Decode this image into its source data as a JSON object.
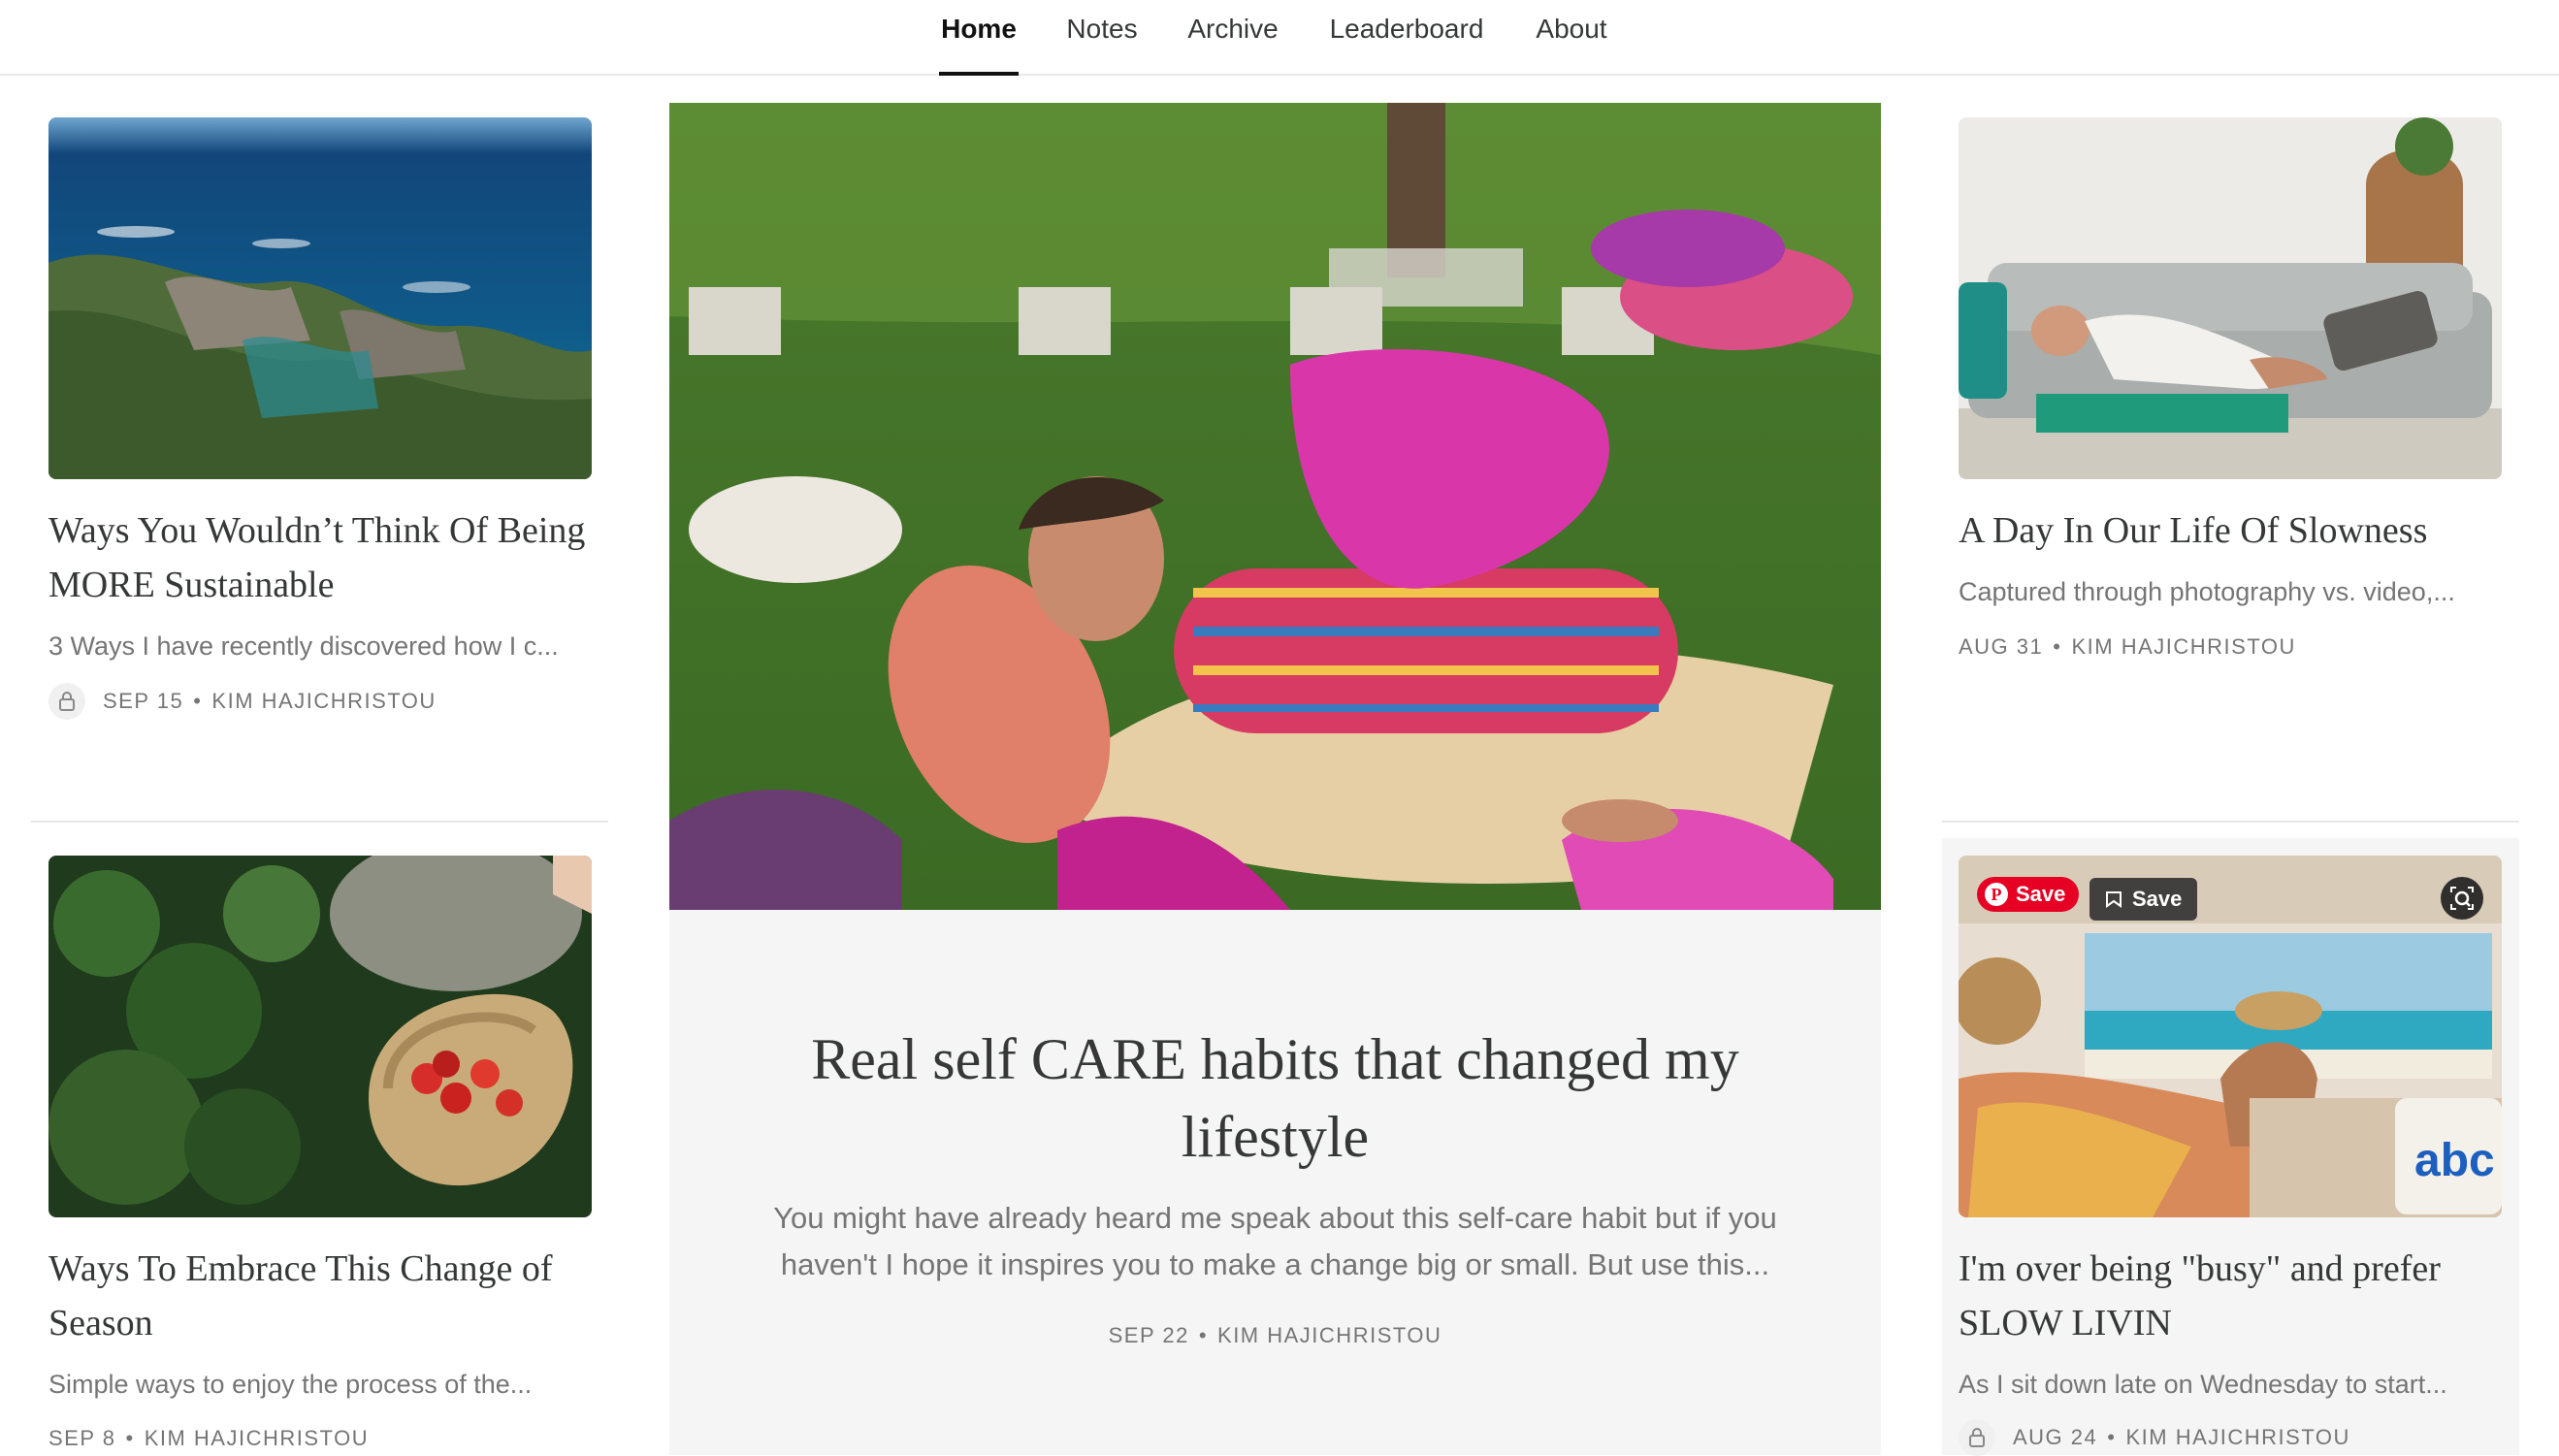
{
  "nav": {
    "items": [
      {
        "label": "Home",
        "active": true
      },
      {
        "label": "Notes"
      },
      {
        "label": "Archive"
      },
      {
        "label": "Leaderboard"
      },
      {
        "label": "About"
      }
    ]
  },
  "left": {
    "post1": {
      "title": "Ways You Wouldn’t Think Of Being MORE Sustainable",
      "subtitle": "3 Ways I have recently discovered how I c...",
      "date": "SEP 15",
      "author": "KIM HAJICHRISTOU",
      "locked": true
    },
    "post2": {
      "title": "Ways To Embrace This Change of Season",
      "subtitle": "Simple ways to enjoy the process of the...",
      "date": "SEP 8",
      "author": "KIM HAJICHRISTOU"
    }
  },
  "featured": {
    "title": "Real self CARE habits that changed my lifestyle",
    "subtitle": "You might have already heard me speak about this self-care habit but if you haven't I hope it inspires you to make a change big or small. But use this...",
    "date": "SEP 22",
    "author": "KIM HAJICHRISTOU"
  },
  "right": {
    "post1": {
      "title": "A Day In Our Life Of Slowness",
      "subtitle": "Captured through photography vs. video,...",
      "date": "AUG 31",
      "author": "KIM HAJICHRISTOU"
    },
    "post2": {
      "title": "I'm over being \"busy\" and prefer SLOW LIVIN",
      "subtitle": "As I sit down late on Wednesday to start...",
      "date": "AUG 24",
      "author": "KIM HAJICHRISTOU",
      "locked": true
    }
  },
  "overlays": {
    "pinterest_save": "Save",
    "bookmark_save": "Save"
  },
  "meta_separator": "•",
  "colors": {
    "text": "#363737",
    "muted": "#757575",
    "feature_bg": "#f5f5f5",
    "pinterest": "#e60023"
  }
}
